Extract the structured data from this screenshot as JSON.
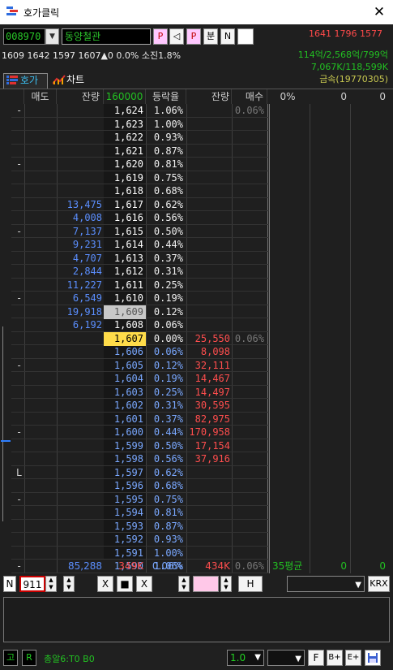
{
  "window": {
    "title": "호가클릭",
    "close_glyph": "✕"
  },
  "toolbar": {
    "code": "008970",
    "name": "동양철관",
    "buttons": [
      "P",
      "◁",
      "P",
      "분",
      "N"
    ],
    "prices": "1641  1796  1577"
  },
  "info": {
    "line": "1609 1642 1597 1607▲0 0.0% 소진1.8%",
    "stat1": "114억/2,568억/799억",
    "stat2": "7,067K/118,599K",
    "stat3": "금속(19770305)"
  },
  "tabs": {
    "hoga": "호가",
    "chart": "차트"
  },
  "headers": {
    "sell": "매도",
    "ask_qty": "잔량",
    "price": "160000",
    "rate": "등락율",
    "bid_qty": "잔량",
    "buy": "매수",
    "r1": "0%",
    "r2": "0",
    "r3": "0"
  },
  "rows": [
    {
      "m": "-",
      "aq": "",
      "p": "1,624",
      "r": "1.06%",
      "bq": "",
      "b": "0.06%"
    },
    {
      "m": "",
      "aq": "",
      "p": "1,623",
      "r": "1.00%",
      "bq": "",
      "b": ""
    },
    {
      "m": "",
      "aq": "",
      "p": "1,622",
      "r": "0.93%",
      "bq": "",
      "b": ""
    },
    {
      "m": "",
      "aq": "",
      "p": "1,621",
      "r": "0.87%",
      "bq": "",
      "b": ""
    },
    {
      "m": "-",
      "aq": "",
      "p": "1,620",
      "r": "0.81%",
      "bq": "",
      "b": ""
    },
    {
      "m": "",
      "aq": "",
      "p": "1,619",
      "r": "0.75%",
      "bq": "",
      "b": ""
    },
    {
      "m": "",
      "aq": "",
      "p": "1,618",
      "r": "0.68%",
      "bq": "",
      "b": ""
    },
    {
      "m": "",
      "aq": "13,475",
      "p": "1,617",
      "r": "0.62%",
      "bq": "",
      "b": ""
    },
    {
      "m": "",
      "aq": "4,008",
      "p": "1,616",
      "r": "0.56%",
      "bq": "",
      "b": ""
    },
    {
      "m": "-",
      "aq": "7,137",
      "p": "1,615",
      "r": "0.50%",
      "bq": "",
      "b": ""
    },
    {
      "m": "",
      "aq": "9,231",
      "p": "1,614",
      "r": "0.44%",
      "bq": "",
      "b": ""
    },
    {
      "m": "",
      "aq": "4,707",
      "p": "1,613",
      "r": "0.37%",
      "bq": "",
      "b": ""
    },
    {
      "m": "",
      "aq": "2,844",
      "p": "1,612",
      "r": "0.31%",
      "bq": "",
      "b": ""
    },
    {
      "m": "",
      "aq": "11,227",
      "p": "1,611",
      "r": "0.25%",
      "bq": "",
      "b": ""
    },
    {
      "m": "-",
      "aq": "6,549",
      "p": "1,610",
      "r": "0.19%",
      "bq": "",
      "b": ""
    },
    {
      "m": "",
      "aq": "19,918",
      "p": "1,609",
      "r": "0.12%",
      "bq": "",
      "b": "",
      "hl": "prev"
    },
    {
      "m": "",
      "aq": "6,192",
      "p": "1,608",
      "r": "0.06%",
      "bq": "",
      "b": ""
    },
    {
      "m": "",
      "aq": "",
      "p": "1,607",
      "r": "0.00%",
      "bq": "25,550",
      "b": "0.06%",
      "hl": "cur"
    },
    {
      "m": "",
      "aq": "",
      "p": "1,606",
      "r": "0.06%",
      "bq": "8,098",
      "b": "",
      "blue": true
    },
    {
      "m": "-",
      "aq": "",
      "p": "1,605",
      "r": "0.12%",
      "bq": "32,111",
      "b": "",
      "blue": true
    },
    {
      "m": "",
      "aq": "",
      "p": "1,604",
      "r": "0.19%",
      "bq": "14,467",
      "b": "",
      "blue": true
    },
    {
      "m": "",
      "aq": "",
      "p": "1,603",
      "r": "0.25%",
      "bq": "14,497",
      "b": "",
      "blue": true
    },
    {
      "m": "",
      "aq": "",
      "p": "1,602",
      "r": "0.31%",
      "bq": "30,595",
      "b": "",
      "blue": true
    },
    {
      "m": "",
      "aq": "",
      "p": "1,601",
      "r": "0.37%",
      "bq": "82,975",
      "b": "",
      "blue": true
    },
    {
      "m": "-",
      "aq": "",
      "p": "1,600",
      "r": "0.44%",
      "bq": "170,958",
      "b": "",
      "blue": true
    },
    {
      "m": "",
      "aq": "",
      "p": "1,599",
      "r": "0.50%",
      "bq": "17,154",
      "b": "",
      "blue": true
    },
    {
      "m": "",
      "aq": "",
      "p": "1,598",
      "r": "0.56%",
      "bq": "37,916",
      "b": "",
      "blue": true
    },
    {
      "m": "L",
      "aq": "",
      "p": "1,597",
      "r": "0.62%",
      "bq": "",
      "b": "",
      "blue": true
    },
    {
      "m": "",
      "aq": "",
      "p": "1,596",
      "r": "0.68%",
      "bq": "",
      "b": "",
      "blue": true
    },
    {
      "m": "-",
      "aq": "",
      "p": "1,595",
      "r": "0.75%",
      "bq": "",
      "b": "",
      "blue": true
    },
    {
      "m": "",
      "aq": "",
      "p": "1,594",
      "r": "0.81%",
      "bq": "",
      "b": "",
      "blue": true
    },
    {
      "m": "",
      "aq": "",
      "p": "1,593",
      "r": "0.87%",
      "bq": "",
      "b": "",
      "blue": true
    },
    {
      "m": "",
      "aq": "",
      "p": "1,592",
      "r": "0.93%",
      "bq": "",
      "b": "",
      "blue": true
    },
    {
      "m": "",
      "aq": "",
      "p": "1,591",
      "r": "1.00%",
      "bq": "",
      "b": "",
      "blue": true
    },
    {
      "m": "-",
      "aq": "",
      "p": "1,590",
      "r": "1.06%",
      "bq": "",
      "b": "0.06%",
      "blue": true
    }
  ],
  "summary": {
    "ask_total": "85,288",
    "price": "349K",
    "rate": "0.06%",
    "bid_total": "434K",
    "avg": "35평균",
    "v1": "0",
    "v2": "0"
  },
  "controls": {
    "n": "N",
    "qty": "911",
    "x1": "X",
    "stop": "■",
    "x2": "X",
    "h": "H",
    "krx": "KRX"
  },
  "statusbar": {
    "go": "고",
    "r": "R",
    "text": "총알6:T0  B0",
    "ratio": "1.0",
    "f": "F",
    "bplus": "B+",
    "eplus": "E+"
  }
}
